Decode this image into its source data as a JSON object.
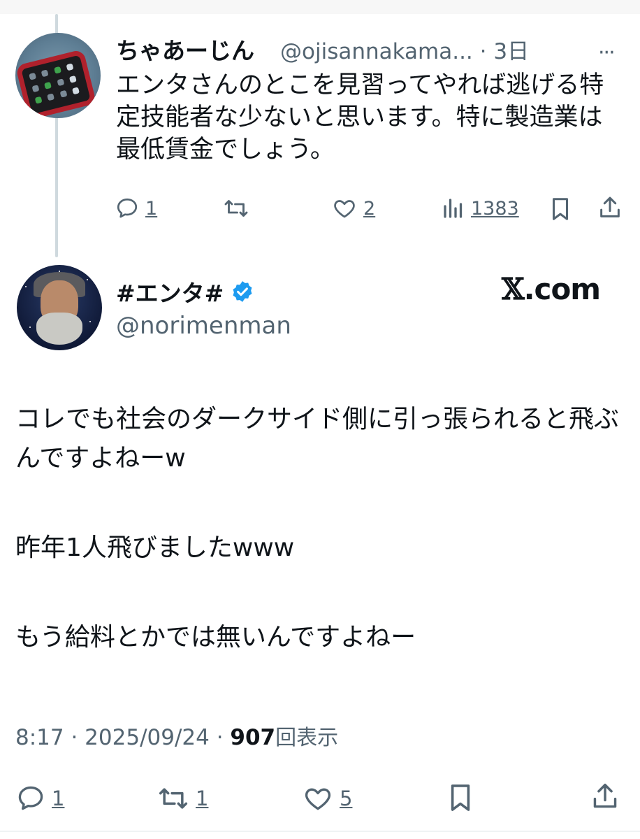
{
  "reply": {
    "display_name": "ちゃあーじん",
    "handle_time": "@ojisannakama... · 3日",
    "more_glyph": "···",
    "text": "エンタさんのとこを見習ってやれば逃げる特定技能者な少ないと思います。特に製造業は最低賃金でしょう。",
    "reply_count": "1",
    "like_count": "2",
    "view_count": "1383"
  },
  "main": {
    "display_name": "#エンタ#",
    "handle": "@norimenman",
    "source": ".com",
    "source_mark": "𝕏",
    "lines": [
      "コレでも社会のダークサイド側に引っ張られると飛ぶんですよねーw",
      "昨年1人飛びましたwww",
      "もう給料とかでは無いんですよねー"
    ],
    "time": "8:17 · 2025/09/24 · ",
    "views": "907",
    "views_label": "回表示",
    "reply_count": "1",
    "repost_count": "1",
    "like_count": "5"
  },
  "colors": {
    "text": "#0f1419",
    "secondary": "#536471",
    "verified": "#1d9bf0",
    "thread_line": "#cfd9de"
  },
  "icons": [
    "reply-icon",
    "repost-icon",
    "like-icon",
    "views-icon",
    "bookmark-icon",
    "share-icon",
    "verified-badge-icon",
    "more-icon"
  ]
}
